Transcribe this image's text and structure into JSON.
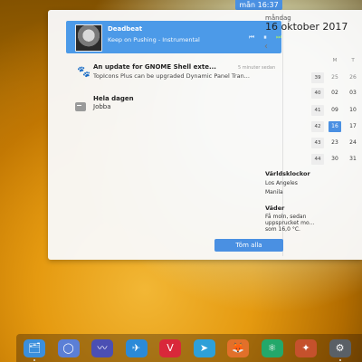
{
  "panel": {
    "clock": "mån 16:37"
  },
  "media_player": {
    "title": "Deadbeat",
    "subtitle": "Keep on Pushing - Instrumental",
    "prev_icon": "⏮",
    "pause_icon": "⏸",
    "next_icon": "⏭"
  },
  "notification": {
    "title": "An update for GNOME Shell exte...",
    "time": "5 minuter sedan",
    "body": "TopIcons Plus can be upgraded Dynamic Panel Tran..."
  },
  "event": {
    "title": "Hela dagen",
    "body": "Jobba"
  },
  "clear_button": "Töm alla",
  "calendar": {
    "weekday": "måndag",
    "date": "16 oktober 2017",
    "prev_icon": "‹",
    "weekdays": [
      "M",
      "T"
    ],
    "weeks": [
      {
        "num": "39",
        "days": [
          "25",
          "26"
        ]
      },
      {
        "num": "40",
        "days": [
          "02",
          "03"
        ]
      },
      {
        "num": "41",
        "days": [
          "09",
          "10"
        ]
      },
      {
        "num": "42",
        "days": [
          "16",
          "17"
        ]
      },
      {
        "num": "43",
        "days": [
          "23",
          "24"
        ]
      },
      {
        "num": "44",
        "days": [
          "30",
          "31"
        ]
      }
    ]
  },
  "world_clocks": {
    "title": "Världsklockor",
    "cities": [
      "Los Angeles",
      "Manila"
    ]
  },
  "weather": {
    "title": "Väder",
    "lines": [
      "Få moln, sedan",
      "uppsprucket mo...",
      "som 16,0 °C."
    ]
  },
  "dock": {
    "apps": [
      {
        "name": "Files",
        "glyph": "🗂",
        "color": "#3b8fdc"
      },
      {
        "name": "Budgie",
        "glyph": "◯",
        "color": "#5b7fd6"
      },
      {
        "name": "Audio",
        "glyph": "〰",
        "color": "#4b4fb3"
      },
      {
        "name": "Safari",
        "glyph": "✈",
        "color": "#2b8ad8"
      },
      {
        "name": "Vivaldi",
        "glyph": "V",
        "color": "#d9283a"
      },
      {
        "name": "Telegram",
        "glyph": "➤",
        "color": "#2ea0d8"
      },
      {
        "name": "Firefox",
        "glyph": "🦊",
        "color": "#e2702a"
      },
      {
        "name": "Atom",
        "glyph": "⚛",
        "color": "#23a86a"
      },
      {
        "name": "Kodi",
        "glyph": "✦",
        "color": "#c5512c"
      },
      {
        "name": "Settings",
        "glyph": "⚙",
        "color": "#5a6066"
      }
    ]
  }
}
